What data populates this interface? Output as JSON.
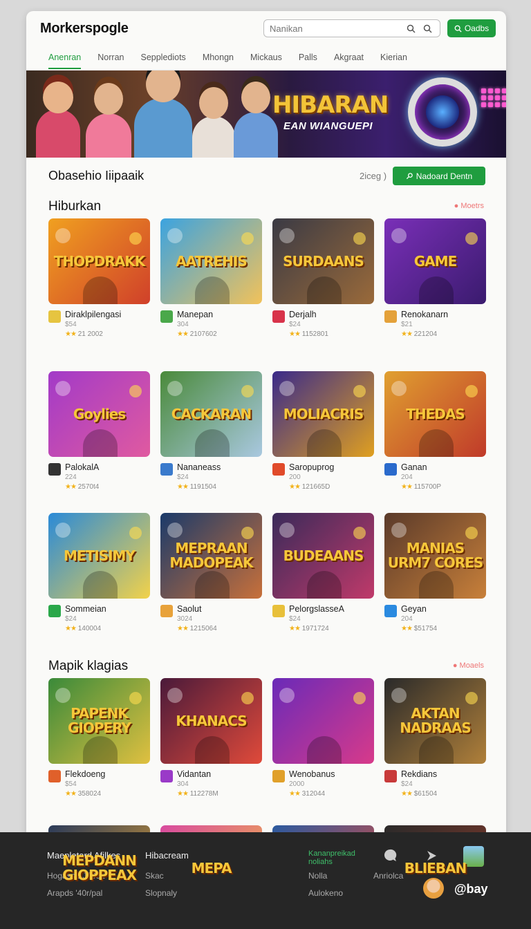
{
  "header": {
    "logo": "Morkerspogle",
    "search_placeholder": "Nanikan",
    "button_label": "Oadbs"
  },
  "tabs": [
    {
      "label": "Anenran"
    },
    {
      "label": "Norran"
    },
    {
      "label": "Sepplediots"
    },
    {
      "label": "Mhongn"
    },
    {
      "label": "Mickaus"
    },
    {
      "label": "Palls"
    },
    {
      "label": "Akgraat"
    },
    {
      "label": "Kierian"
    }
  ],
  "banner": {
    "title": "HIBARAN",
    "subtitle": "EAN WIANGUEPI"
  },
  "subhead": {
    "title": "Obasehio Iiipaaik",
    "count": "2iceg )",
    "button_label": "Nadoard Dentn"
  },
  "sections": [
    {
      "title": "Hiburkan",
      "more": "Moetrs",
      "items": [
        {
          "art": "THOPDRAKK",
          "name": "Diraklpilengasi",
          "price": "$54",
          "rating": "21 2002",
          "colors": [
            "#f0a020",
            "#d0402a"
          ],
          "icon": "#e6c440"
        },
        {
          "art": "AATREHIS",
          "name": "Manepan",
          "price": "304",
          "rating": "2107602",
          "colors": [
            "#3ba3e0",
            "#f2c25a"
          ],
          "icon": "#4aa84a"
        },
        {
          "art": "SURDAANS",
          "name": "Derjalh",
          "price": "$24",
          "rating": "1152801",
          "colors": [
            "#3a3a44",
            "#9a6a3a"
          ],
          "icon": "#d8334a"
        },
        {
          "art": "GAME",
          "name": "Renokanarn",
          "price": "$21",
          "rating": "221204",
          "colors": [
            "#7a2fb8",
            "#3a1b6e"
          ],
          "icon": "#e4a13a"
        }
      ]
    },
    {
      "title": "",
      "more": "",
      "items": [
        {
          "art": "Goylies",
          "name": "PalokalА",
          "price": "224",
          "rating": "2570t4",
          "colors": [
            "#a23ac8",
            "#e05aa0"
          ],
          "icon": "#333"
        },
        {
          "art": "CACKARAN",
          "name": "Nananeass",
          "price": "$24",
          "rating": "1191504",
          "colors": [
            "#4a8a3a",
            "#a9c8e0"
          ],
          "icon": "#3a7acc"
        },
        {
          "art": "MOLIACRIS",
          "name": "Saropuprog",
          "price": "200",
          "rating": "121665D",
          "colors": [
            "#3a2a8a",
            "#e0a020"
          ],
          "icon": "#e04a2a"
        },
        {
          "art": "THEDAS",
          "name": "Ganan",
          "price": "204",
          "rating": "115700P",
          "colors": [
            "#e0a030",
            "#c03a2a"
          ],
          "icon": "#2a6acc"
        }
      ]
    },
    {
      "title": "",
      "more": "",
      "items": [
        {
          "art": "METISIMY",
          "name": "Sommeian",
          "price": "$24",
          "rating": "140004",
          "colors": [
            "#2a8ad8",
            "#f2d24a"
          ],
          "icon": "#2aa84a"
        },
        {
          "art": "MEPRAAN MADOPEAK",
          "name": "Saolut",
          "price": "3024",
          "rating": "1215064",
          "colors": [
            "#1a3a6a",
            "#c8703a"
          ],
          "icon": "#e8a23a"
        },
        {
          "art": "BUDEAANS",
          "name": "PelorgslasseА",
          "price": "$24",
          "rating": "1971724",
          "colors": [
            "#3a2a5a",
            "#c03a6a"
          ],
          "icon": "#e8c03a"
        },
        {
          "art": "MANIAS URM7 CORES",
          "name": "Geyan",
          "price": "204",
          "rating": "$51754",
          "colors": [
            "#5a3a2a",
            "#c8803a"
          ],
          "icon": "#2a8ae0"
        }
      ]
    },
    {
      "title": "Mapik klagias",
      "more": "Moaels",
      "items": [
        {
          "art": "PAPENK GIOPERY",
          "name": "Flekdoeng",
          "price": "$54",
          "rating": "358024",
          "colors": [
            "#3a8a3a",
            "#e0c040"
          ],
          "icon": "#e0602a"
        },
        {
          "art": "KHANACS",
          "name": "Vidantan",
          "price": "304",
          "rating": "112278M",
          "colors": [
            "#4a1a3a",
            "#e04a3a"
          ],
          "icon": "#9a3ac8"
        },
        {
          "art": "",
          "name": "Wenobanus",
          "price": "2000",
          "rating": "312044",
          "colors": [
            "#6a2ab8",
            "#d83a8a"
          ],
          "icon": "#e0a02a"
        },
        {
          "art": "AKTAN NADRAAS",
          "name": "Rekdians",
          "price": "$24",
          "rating": "$61504",
          "colors": [
            "#2a2a2a",
            "#b0803a"
          ],
          "icon": "#c83a3a"
        }
      ]
    },
    {
      "title": "",
      "more": "",
      "items": [
        {
          "art": "MEPDANN GIOPPEAX",
          "name": "",
          "price": "",
          "rating": "",
          "colors": [
            "#2a3a5a",
            "#e0a030"
          ],
          "icon": "#888"
        },
        {
          "art": "MEPA",
          "name": "",
          "price": "",
          "rating": "",
          "colors": [
            "#d84aa0",
            "#f2c040"
          ],
          "icon": "#888"
        },
        {
          "art": "",
          "name": "",
          "price": "",
          "rating": "",
          "colors": [
            "#2a5aa0",
            "#e04a3a"
          ],
          "icon": "#888"
        },
        {
          "art": "BLIEBAN",
          "name": "",
          "price": "",
          "rating": "",
          "colors": [
            "#2a2a2a",
            "#8a3a2a"
          ],
          "icon": "#888"
        }
      ]
    }
  ],
  "footer": {
    "col1_title": "Maepletard Afilkes",
    "col1_items": [
      "Hogass-2J7051",
      "Arapds '40r/pal"
    ],
    "col2_title": "Hibacream",
    "col2_items": [
      "Skac",
      "Slopnaly"
    ],
    "col3_title": "Kananpreikad noliahs",
    "col3_items": [
      "Nolla",
      "Aulokeno"
    ],
    "col4_item": "Anriolca",
    "brand": "@bay"
  }
}
